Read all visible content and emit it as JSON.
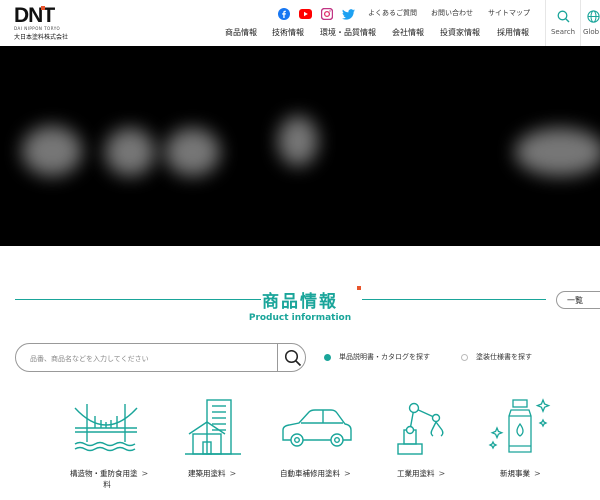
{
  "header": {
    "logo_text": "DNT",
    "logo_sub": "DAI NIPPON TORYO",
    "company_name": "大日本塗料株式会社",
    "social": [
      "facebook-icon",
      "youtube-icon",
      "instagram-icon",
      "twitter-icon"
    ],
    "top_links": [
      "よくあるご質問",
      "お問い合わせ",
      "サイトマップ"
    ],
    "nav": [
      "商品情報",
      "技術情報",
      "環境・品質情報",
      "会社情報",
      "投資家情報",
      "採用情報"
    ],
    "search_label": "Search",
    "global_label": "Glob"
  },
  "section": {
    "title": "商品情報",
    "subtitle": "Product information",
    "list_button": "一覧",
    "search_placeholder": "品番、商品名などを入力してください",
    "radio_options": [
      "単品説明書・カタログを探す",
      "塗装仕様書を探す"
    ],
    "selected_radio": 0,
    "categories": [
      {
        "line1": "構造物・重防食用塗",
        "line2": "料",
        "icon": "bridge-icon"
      },
      {
        "line1": "建築用塗料",
        "icon": "building-icon"
      },
      {
        "line1": "自動車補修用塗料",
        "icon": "car-icon"
      },
      {
        "line1": "工業用塗料",
        "icon": "robot-arm-icon"
      },
      {
        "line1": "新規事業",
        "icon": "bottle-sparkle-icon"
      }
    ]
  },
  "colors": {
    "accent": "#1aa59a",
    "brand_orange": "#e8542b"
  }
}
